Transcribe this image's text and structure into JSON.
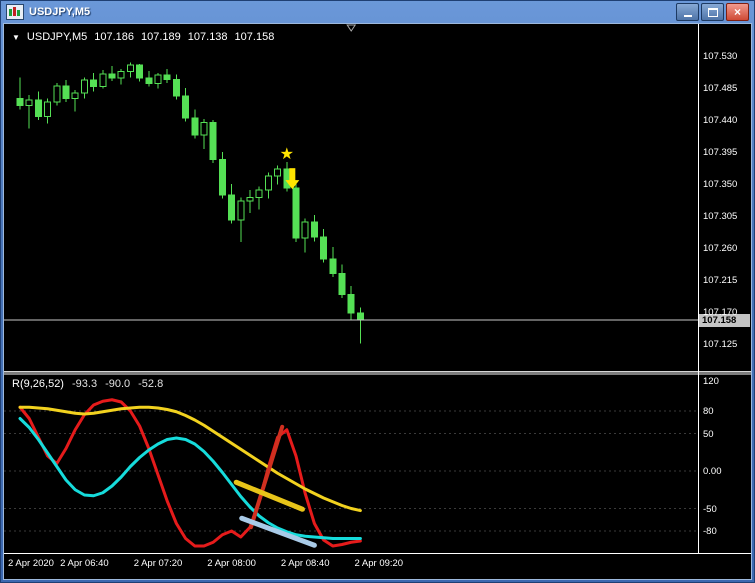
{
  "window": {
    "title": "USDJPY,M5"
  },
  "ohlc_info": {
    "symbol": "USDJPY,M5",
    "open": "107.186",
    "high": "107.189",
    "low": "107.138",
    "close": "107.158"
  },
  "price_axis": {
    "labels": [
      "107.530",
      "107.485",
      "107.440",
      "107.395",
      "107.350",
      "107.305",
      "107.260",
      "107.215",
      "107.170",
      "107.125"
    ],
    "current": "107.158"
  },
  "time_axis": {
    "labels": [
      "2 Apr 2020",
      "2 Apr 06:40",
      "2 Apr 07:20",
      "2 Apr 08:00",
      "2 Apr 08:40",
      "2 Apr 09:20"
    ]
  },
  "indicator_panel": {
    "name": "R(9,26,52)",
    "values": [
      "-93.3",
      "-90.0",
      "-52.8"
    ],
    "axis_labels": [
      "120",
      "80",
      "50",
      "0.00",
      "-50",
      "-80"
    ]
  },
  "chart_data": {
    "type": "candlestick",
    "title": "USDJPY,M5",
    "symbol": "USDJPY",
    "timeframe_minutes": 5,
    "y_axis": {
      "min": 107.125,
      "max": 107.53,
      "tick_interval": 0.045
    },
    "current_price": 107.158,
    "colors": {
      "candle": "#55e055",
      "bull_fill": "#000000",
      "bid_line": "#c8c8c8",
      "background": "#000000",
      "axis_text": "#ffffff"
    },
    "candles": [
      [
        107.47,
        107.5,
        107.455,
        107.46
      ],
      [
        107.46,
        107.475,
        107.428,
        107.468
      ],
      [
        107.468,
        107.48,
        107.44,
        107.445
      ],
      [
        107.445,
        107.47,
        107.435,
        107.465
      ],
      [
        107.465,
        107.492,
        107.46,
        107.488
      ],
      [
        107.488,
        107.496,
        107.465,
        107.47
      ],
      [
        107.47,
        107.482,
        107.452,
        107.478
      ],
      [
        107.478,
        107.5,
        107.47,
        107.496
      ],
      [
        107.496,
        107.506,
        107.48,
        107.487
      ],
      [
        107.487,
        107.51,
        107.484,
        107.505
      ],
      [
        107.505,
        107.516,
        107.495,
        107.499
      ],
      [
        107.499,
        107.512,
        107.49,
        107.508
      ],
      [
        107.508,
        107.521,
        107.5,
        107.517
      ],
      [
        107.517,
        107.519,
        107.494,
        107.499
      ],
      [
        107.499,
        107.509,
        107.487,
        107.491
      ],
      [
        107.491,
        107.506,
        107.484,
        107.503
      ],
      [
        107.503,
        107.512,
        107.492,
        107.497
      ],
      [
        107.497,
        107.504,
        107.469,
        107.474
      ],
      [
        107.474,
        107.485,
        107.438,
        107.443
      ],
      [
        107.443,
        107.455,
        107.414,
        107.419
      ],
      [
        107.419,
        107.441,
        107.399,
        107.436
      ],
      [
        107.436,
        107.44,
        107.379,
        107.384
      ],
      [
        107.384,
        107.395,
        107.329,
        107.334
      ],
      [
        107.334,
        107.35,
        107.294,
        107.299
      ],
      [
        107.299,
        107.331,
        107.268,
        107.326
      ],
      [
        107.326,
        107.341,
        107.309,
        107.331
      ],
      [
        107.331,
        107.346,
        107.314,
        107.341
      ],
      [
        107.341,
        107.366,
        107.329,
        107.361
      ],
      [
        107.361,
        107.376,
        107.349,
        107.371
      ],
      [
        107.371,
        107.381,
        107.339,
        107.344
      ],
      [
        107.344,
        107.35,
        107.268,
        107.274
      ],
      [
        107.274,
        107.301,
        107.253,
        107.296
      ],
      [
        107.296,
        107.306,
        107.269,
        107.275
      ],
      [
        107.275,
        107.286,
        107.239,
        107.244
      ],
      [
        107.244,
        107.261,
        107.219,
        107.224
      ],
      [
        107.224,
        107.236,
        107.189,
        107.194
      ],
      [
        107.194,
        107.206,
        107.158,
        107.168
      ],
      [
        107.168,
        107.176,
        107.125,
        107.158
      ]
    ],
    "time_ticks": {
      "candle_indices": [
        0,
        7,
        15,
        23,
        31,
        39
      ]
    },
    "annotations": [
      {
        "type": "star",
        "bar_index": 29,
        "price": 107.392,
        "color": "#ffe400"
      },
      {
        "type": "arrow-down",
        "bar_index": 29.6,
        "price": 107.372,
        "color": "#ffe400"
      },
      {
        "type": "shift-marker",
        "bar_index": 36
      }
    ],
    "indicator": {
      "name": "R(9,26,52)",
      "range_top": 120,
      "range_bottom": -100,
      "grid_levels": [
        80,
        50,
        0,
        -50,
        -80
      ],
      "series": [
        {
          "name": "R9",
          "color": "#e51b1b",
          "width": 3,
          "values": [
            85,
            70,
            45,
            20,
            10,
            30,
            55,
            75,
            88,
            93,
            95,
            92,
            80,
            60,
            30,
            -5,
            -40,
            -70,
            -90,
            -100,
            -100,
            -95,
            -85,
            -80,
            -88,
            -75,
            -40,
            5,
            45,
            55,
            20,
            -30,
            -70,
            -92,
            -100,
            -98,
            -95,
            -93.3
          ]
        },
        {
          "name": "R26",
          "color": "#16dcdc",
          "width": 3,
          "values": [
            70,
            58,
            42,
            24,
            6,
            -12,
            -25,
            -32,
            -33,
            -29,
            -20,
            -8,
            6,
            18,
            28,
            36,
            42,
            44,
            42,
            36,
            26,
            13,
            -2,
            -18,
            -34,
            -48,
            -60,
            -69,
            -76,
            -81,
            -85,
            -87,
            -88,
            -89,
            -90,
            -90,
            -90,
            -90
          ]
        },
        {
          "name": "R52",
          "color": "#f2d21f",
          "width": 3,
          "values": [
            85,
            85,
            84,
            83,
            81,
            79,
            77,
            76,
            77,
            79,
            81,
            83,
            84,
            85,
            85,
            84,
            82,
            79,
            74,
            68,
            61,
            53,
            45,
            37,
            29,
            21,
            13,
            5,
            -3,
            -10,
            -17,
            -24,
            -30,
            -36,
            -41,
            -46,
            -50,
            -52.8
          ]
        }
      ],
      "objects": [
        {
          "type": "trendline",
          "color": "#d03020",
          "width": 4,
          "x1": 25.1,
          "v1": -75,
          "x2": 28.5,
          "v2": 59
        },
        {
          "type": "trendline",
          "color": "#e7c419",
          "width": 5,
          "x1": 23.5,
          "v1": -15,
          "x2": 30.7,
          "v2": -51
        },
        {
          "type": "trendline",
          "color": "#a9cbe8",
          "width": 5,
          "x1": 24.1,
          "v1": -63,
          "x2": 32.0,
          "v2": -99
        }
      ]
    }
  }
}
